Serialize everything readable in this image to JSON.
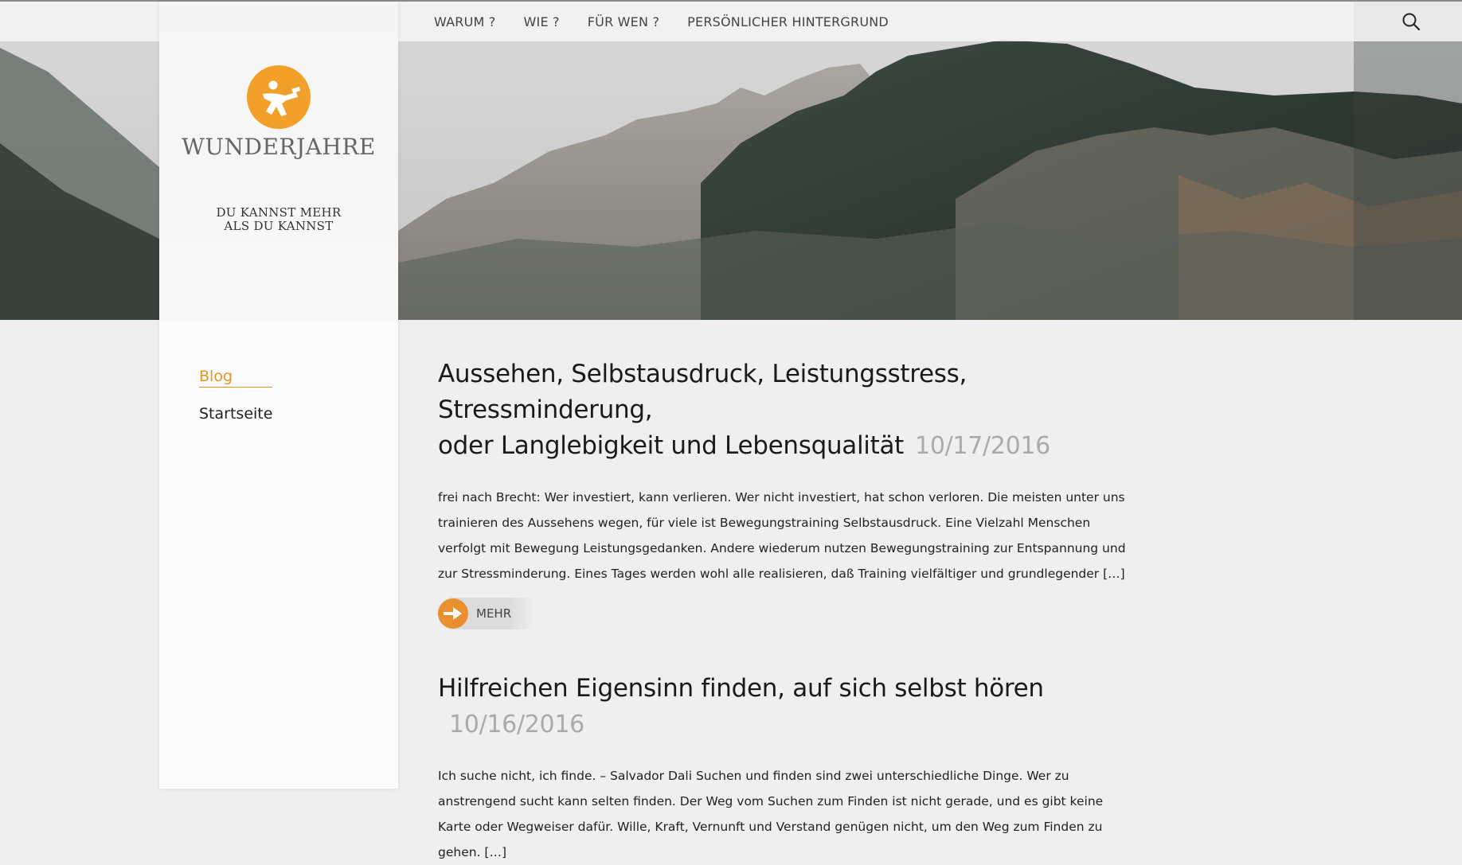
{
  "nav": {
    "items": [
      "WARUM ?",
      "WIE ?",
      "FÜR WEN ?",
      "PERSÖNLICHER HINTERGRUND"
    ],
    "search_icon": "search-icon"
  },
  "brand": {
    "name": "WUNDERJAHRE",
    "tagline_line1": "DU KANNST MEHR",
    "tagline_line2": "ALS DU KANNST",
    "logo_color": "#F2A02A"
  },
  "sidebar": {
    "items": [
      {
        "label": "Blog",
        "active": true
      },
      {
        "label": "Startseite",
        "active": false
      }
    ]
  },
  "posts": [
    {
      "title_line1": "Aussehen, Selbstausdruck, Leistungsstress, Stressminderung,",
      "title_line2": "oder Langlebigkeit und Lebensqualität",
      "date": "10/17/2016",
      "excerpt": "frei nach Brecht: Wer investiert, kann verlieren. Wer nicht investiert, hat schon verloren. Die meisten unter uns trainieren des Aussehens wegen, für viele ist Bewegungstraining Selbstausdruck. Eine Vielzahl Menschen verfolgt mit Bewegung Leistungsgedanken. Andere wiederum nutzen Bewegungstraining zur Entspannung und zur Stressminderung. Eines Tages werden wohl alle realisieren, daß Training vielfältiger und grundlegender […]",
      "more_label": "MEHR"
    },
    {
      "title_line1": "Hilfreichen Eigensinn finden, auf sich selbst hören",
      "date": "10/16/2016",
      "excerpt": "Ich suche nicht, ich finde. – Salvador Dali Suchen und finden sind zwei unterschiedliche Dinge. Wer zu anstrengend sucht kann selten finden. Der Weg vom Suchen zum Finden ist nicht gerade, und es gibt keine Karte oder Wegweiser dafür. Wille, Kraft, Vernunft und Verstand genügen nicht, um den Weg zum Finden zu gehen. […]"
    }
  ],
  "colors": {
    "accent": "#E6951E",
    "page_bg": "#EFEFEF",
    "date_gray": "#AAAAAA"
  }
}
